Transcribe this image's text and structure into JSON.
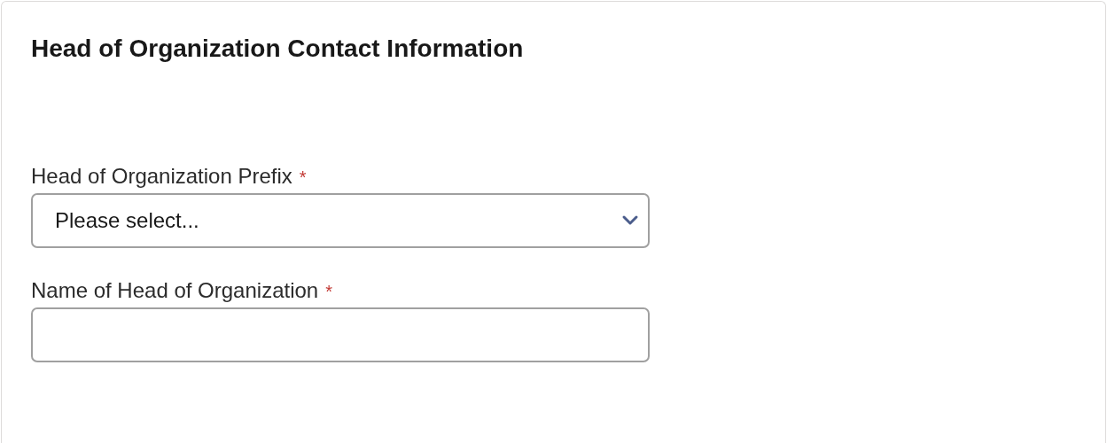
{
  "section": {
    "title": "Head of Organization Contact Information"
  },
  "fields": [
    {
      "kind": "select",
      "label": "Head of Organization Prefix",
      "required_mark": "*",
      "value": "Please select..."
    },
    {
      "kind": "text",
      "label": "Name of Head of Organization",
      "required_mark": "*"
    }
  ]
}
